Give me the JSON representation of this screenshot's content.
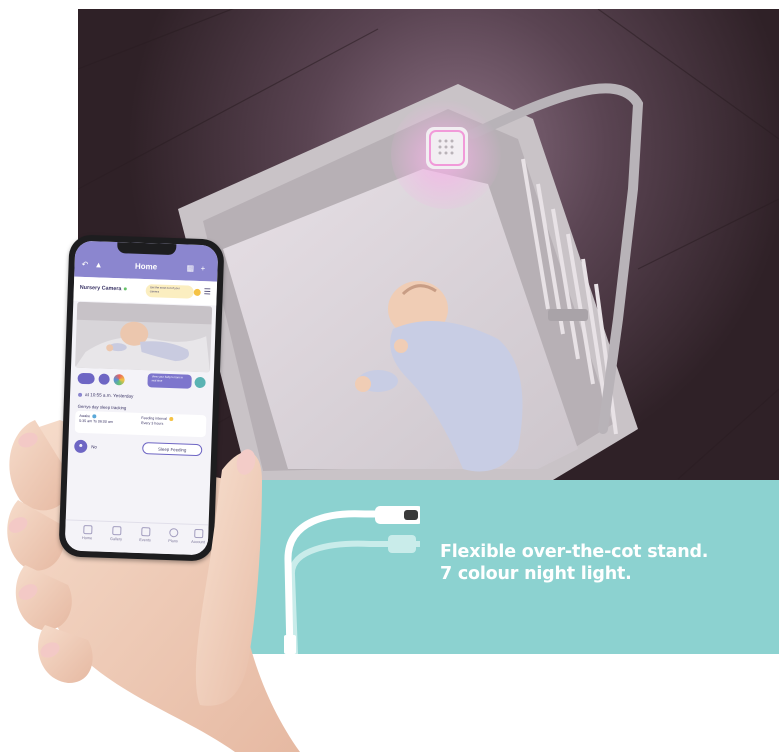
{
  "caption": {
    "line1": "Flexible over-the-cot stand.",
    "line2": "7 colour night light."
  },
  "app": {
    "title": "Home",
    "camera_name": "Nursery Camera",
    "camera_tip": "Get the most out of your camera",
    "control_hint": "View your baby's room in real time",
    "last_seen": "at 10:55 a.m. Yesterday",
    "sleep_tracking_title": "Gerrys day sleep tracking",
    "sleep": {
      "awake_label": "Awake",
      "awake_time": "5:35 am To 06:00 am",
      "feeding_label": "Feeding interval",
      "feeding_time": "Every 3 hours"
    },
    "tag_label": "No",
    "feeding_button": "Sleep Feeding",
    "tabs": [
      {
        "label": "Home"
      },
      {
        "label": "Gallery"
      },
      {
        "label": "Events"
      },
      {
        "label": "Plans"
      },
      {
        "label": "Account"
      }
    ]
  },
  "colors": {
    "teal_panel": "#8cd2d0",
    "app_purple": "#8b86cf",
    "caption_text": "#ffffff"
  }
}
